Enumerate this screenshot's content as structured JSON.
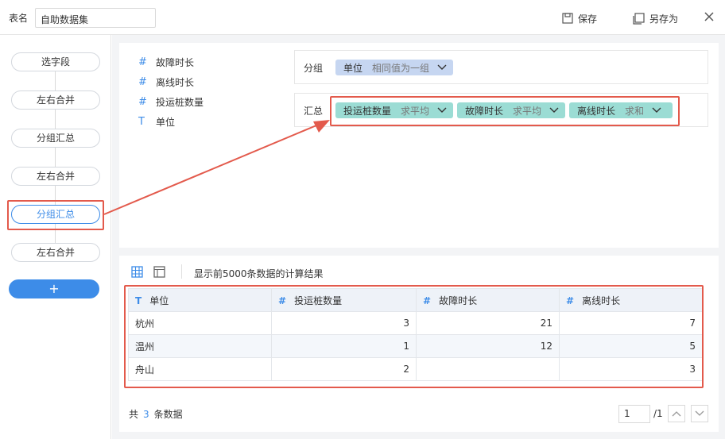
{
  "topbar": {
    "table_name_label": "表名",
    "table_name_value": "自助数据集",
    "save_label": "保存",
    "save_as_label": "另存为"
  },
  "steps": [
    {
      "label": "选字段"
    },
    {
      "label": "左右合并"
    },
    {
      "label": "分组汇总"
    },
    {
      "label": "左右合并"
    },
    {
      "label": "分组汇总",
      "active": true
    },
    {
      "label": "左右合并"
    }
  ],
  "add_step_label": "+",
  "fields": [
    {
      "type_icon": "#",
      "name": "故障时长"
    },
    {
      "type_icon": "#",
      "name": "离线时长"
    },
    {
      "type_icon": "#",
      "name": "投运桩数量"
    },
    {
      "type_icon": "T",
      "name": "单位"
    }
  ],
  "group_row": {
    "label": "分组",
    "chips": [
      {
        "name": "单位",
        "mode": "相同值为一组"
      }
    ]
  },
  "summary_row": {
    "label": "汇总",
    "chips": [
      {
        "name": "投运桩数量",
        "mode": "求平均"
      },
      {
        "name": "故障时长",
        "mode": "求平均"
      },
      {
        "name": "离线时长",
        "mode": "求和"
      }
    ]
  },
  "preview": {
    "info": "显示前5000条数据的计算结果",
    "columns": [
      {
        "type_icon": "T",
        "name": "单位"
      },
      {
        "type_icon": "#",
        "name": "投运桩数量"
      },
      {
        "type_icon": "#",
        "name": "故障时长"
      },
      {
        "type_icon": "#",
        "name": "离线时长"
      }
    ],
    "rows": [
      [
        "杭州",
        "3",
        "21",
        "7"
      ],
      [
        "温州",
        "1",
        "12",
        "5"
      ],
      [
        "舟山",
        "2",
        "",
        "3"
      ]
    ]
  },
  "footer": {
    "prefix": "共",
    "count": "3",
    "suffix": "条数据",
    "page_value": "1",
    "page_total": "/1"
  },
  "colors": {
    "accent": "#3d8ce8",
    "highlight_red": "#e35a4c",
    "group_chip": "#c6d6f1",
    "summary_chip": "#9bdcd4"
  }
}
